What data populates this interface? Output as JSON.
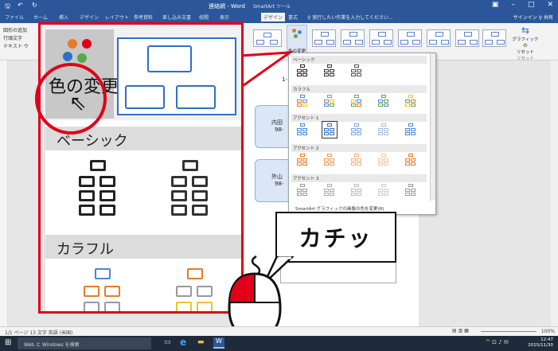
{
  "titlebar": {
    "doc_title": "連絡網 - Word",
    "tool_label": "SmartArt ツール",
    "controls": [
      "▣",
      "–",
      "□",
      "✕"
    ]
  },
  "tabs": [
    "ファイル",
    "ホーム",
    "挿入",
    "デザイン",
    "レイアウト",
    "参考資料",
    "差し込み文書",
    "校閲",
    "表示",
    "デザイン",
    "書式"
  ],
  "tell_me": "♀ 実行したい作業を入力してください...",
  "signin": "サインイン  ♀ 共有",
  "ribbon": {
    "left_items": [
      "図形の追加",
      "行頭文字",
      "テキスト ウ"
    ],
    "color_change_label": "色の変更",
    "reset_label_1": "グラフィックの",
    "reset_label_2": "リセット",
    "reset_group": "リセット"
  },
  "dropdown": {
    "basic": "ベーシック",
    "colorful": "カラフル",
    "accent1": "アクセント 1",
    "accent2": "アクセント 2",
    "accent3": "アクセント 3",
    "footer": "SmartArt グラフィックの画像の色を変更(R)"
  },
  "doc": {
    "card1_name": "内田",
    "card1_num": "98-",
    "card2_name": "外山",
    "card2_num": "98-",
    "marker": "1-"
  },
  "zoom": {
    "color_change": "色の変更",
    "basic": "ベーシック",
    "colorful": "カラフル"
  },
  "balloon": {
    "text": "カチッ"
  },
  "statusbar": {
    "left": "1/1 ページ   13 文字   英語 (米国)",
    "zoom": "100%"
  },
  "taskbar": {
    "search": "Web と Windows を検索",
    "time": "12:47",
    "date": "2015/11/30"
  },
  "colors": {
    "word_blue": "#2b579a",
    "callout_red": "#e0001a",
    "smartart_blue": "#2f6fc7"
  }
}
